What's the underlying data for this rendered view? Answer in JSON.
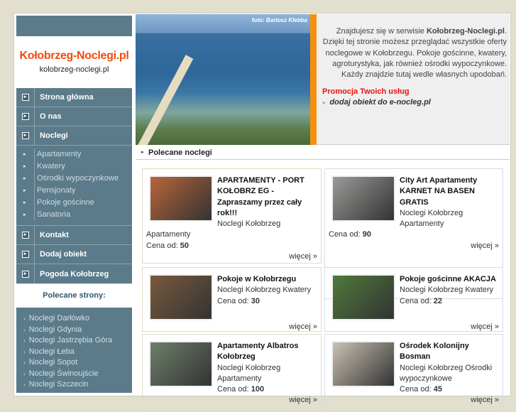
{
  "site": {
    "logo_title": "Kołobrzeg-Noclegi.pl",
    "logo_subtitle": "kolobrzeg-noclegi.pl"
  },
  "nav": {
    "main": [
      {
        "label": "Strona główna"
      },
      {
        "label": "O nas"
      },
      {
        "label": "Noclegi"
      }
    ],
    "sub": [
      "Apartamenty",
      "Kwatery",
      "Ośrodki wypoczynkowe",
      "Pensjonaty",
      "Pokoje gościnne",
      "Sanatoria"
    ],
    "bottom": [
      {
        "label": "Kontakt"
      },
      {
        "label": "Dodaj obiekt"
      },
      {
        "label": "Pogoda Kołobrzeg"
      }
    ]
  },
  "recommended_sites": {
    "title": "Polecane strony:",
    "items": [
      "Noclegi Darłówko",
      "Noclegi Gdynia",
      "Noclegi Jastrzębia Góra",
      "Noclegi Łeba",
      "Noclegi Sopot",
      "Noclegi Świnoujście",
      "Noclegi Szczecin"
    ]
  },
  "photo": {
    "caption": "foto: Bartosz Klebba"
  },
  "intro": {
    "pre": "Znajdujesz się w serwisie ",
    "brand": "Kołobrzeg-Noclegi.pl",
    "post": ". Dzięki tej stronie możesz przeglądać wszystkie oferty noclegowe w Kołobrzegu. Pokoje gościnne, kwatery, agroturystyka, jak również ośrodki wypoczynkowe. Każdy znajdzie tutaj wedle własnych upodobań.",
    "promo_title": "Promocja Twoich usług",
    "promo_link": "dodaj obiekt do e-nocleg.pl"
  },
  "featured": {
    "title": "Polecane noclegi",
    "price_label": "Cena od: ",
    "more_label": "więcej »",
    "items": [
      {
        "title": "APARTAMENTY - PORT KOŁOBRZ EG - Zapraszamy przez cały rok!!!",
        "category": "Noclegi Kołobrzeg Apartamenty",
        "price": "50",
        "img": "#b8653a"
      },
      {
        "title": "City Art Apartamenty KARNET NA BASEN GRATIS",
        "category": "Noclegi Kołobrzeg Apartamenty",
        "price": "90",
        "img": "#9a9a98"
      },
      {
        "title": "Pokoje w Kołobrzegu",
        "category": "Noclegi Kołobrzeg Kwatery",
        "price": "30",
        "img": "#7a5a3e"
      },
      {
        "title": "Pokoje gościnne AKACJA",
        "category": "Noclegi Kołobrzeg Kwatery",
        "price": "22",
        "img": "#4f7a3a"
      },
      {
        "title": "Apartamenty Albatros Kołobrzeg",
        "category": "Noclegi Kołobrzeg Apartamenty",
        "price": "100",
        "img": "#6d7f6a"
      },
      {
        "title": "Ośrodek Kolonijny Bosman",
        "category": "Noclegi Kołobrzeg Ośrodki wypoczynkowe",
        "price": "45",
        "img": "#c9c2b4"
      }
    ]
  }
}
